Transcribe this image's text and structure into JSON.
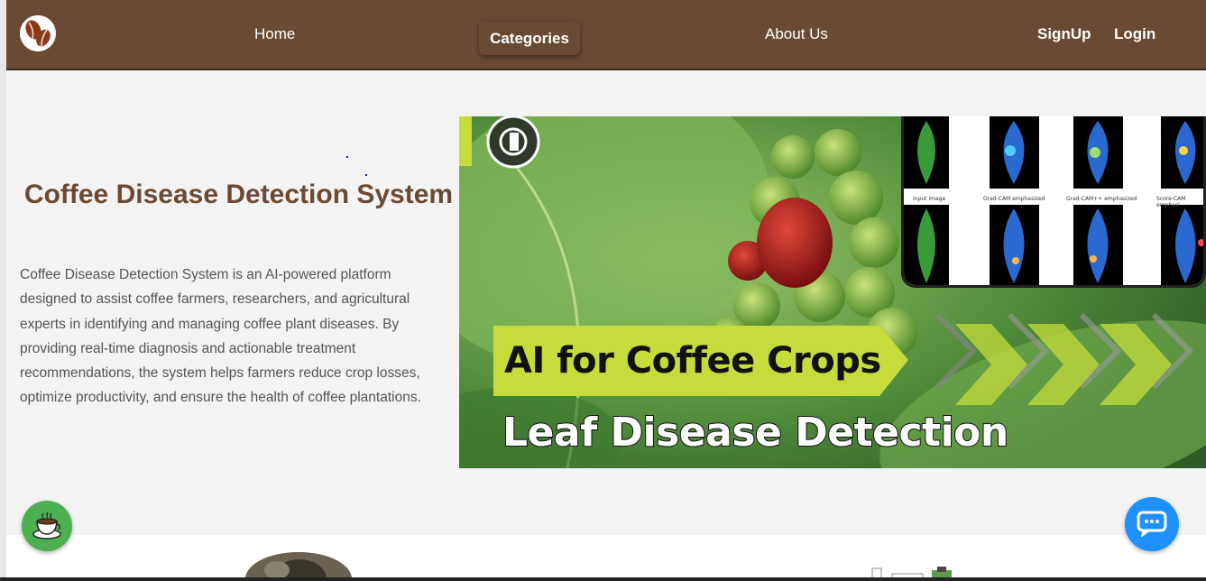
{
  "nav": {
    "home": "Home",
    "categories": "Categories",
    "about": "About Us",
    "signup": "SignUp",
    "login": "Login"
  },
  "hero": {
    "title": "Coffee Disease Detection System",
    "description": "Coffee Disease Detection System is an AI-powered platform designed to assist coffee farmers, researchers, and agricultural experts in identifying and managing coffee plant diseases. By providing real-time diagnosis and actionable treatment recommendations, the system helps farmers reduce crop losses, optimize productivity, and ensure the health of coffee plantations."
  },
  "banner": {
    "line1": "AI for Coffee Crops",
    "line2": "Leaf Disease Detection",
    "captions": [
      "Input image",
      "Grad-CAM emphasized",
      "Grad-CAM++ emphasized",
      "Score-CAM emphasi"
    ]
  },
  "icons": {
    "logo": "coffee-beans-icon",
    "coffee_fab": "coffee-cup-icon",
    "chat_fab": "chat-bubble-icon"
  },
  "colors": {
    "brand_brown": "#6b4a33",
    "accent_green": "#c5dc3a",
    "chat_blue": "#1e90ff",
    "fab_green": "#4caf50"
  }
}
